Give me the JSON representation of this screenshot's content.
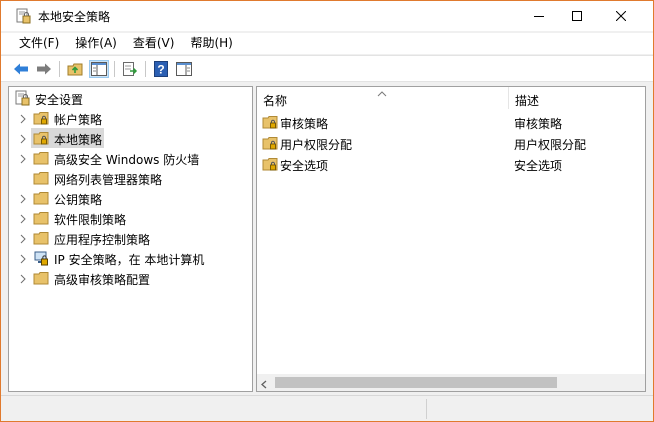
{
  "window": {
    "title": "本地安全策略"
  },
  "menu": [
    "文件(F)",
    "操作(A)",
    "查看(V)",
    "帮助(H)"
  ],
  "toolbar": {
    "buttons": [
      "back-arrow-icon",
      "forward-arrow-icon",
      "up-folder-icon",
      "show-hide-tree-icon",
      "export-list-icon",
      "help-icon",
      "action-pane-icon"
    ]
  },
  "tree": {
    "root": "安全设置",
    "items": [
      {
        "label": "帐户策略",
        "expandable": true,
        "icon": "locked-folder-icon"
      },
      {
        "label": "本地策略",
        "expandable": true,
        "icon": "locked-folder-icon",
        "selected": true
      },
      {
        "label": "高级安全 Windows 防火墙",
        "expandable": true,
        "icon": "folder-icon"
      },
      {
        "label": "网络列表管理器策略",
        "expandable": false,
        "icon": "folder-icon"
      },
      {
        "label": "公钥策略",
        "expandable": true,
        "icon": "folder-icon"
      },
      {
        "label": "软件限制策略",
        "expandable": true,
        "icon": "folder-icon"
      },
      {
        "label": "应用程序控制策略",
        "expandable": true,
        "icon": "folder-icon"
      },
      {
        "label": "IP 安全策略，在 本地计算机",
        "expandable": true,
        "icon": "ip-security-icon"
      },
      {
        "label": "高级审核策略配置",
        "expandable": true,
        "icon": "folder-icon"
      }
    ]
  },
  "list": {
    "columns": {
      "name": "名称",
      "description": "描述"
    },
    "rows": [
      {
        "name": "审核策略",
        "description": "审核策略"
      },
      {
        "name": "用户权限分配",
        "description": "用户权限分配"
      },
      {
        "name": "安全选项",
        "description": "安全选项"
      }
    ]
  },
  "colors": {
    "window_border": "#e07a2e",
    "selection": "#d9d9d9",
    "folder": "#e8c26a"
  }
}
